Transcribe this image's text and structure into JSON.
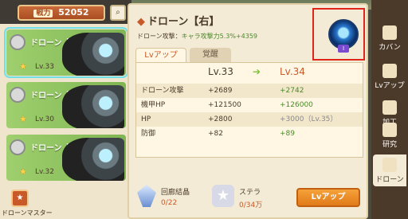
{
  "left": {
    "power_label": "戦力",
    "power_value": "52052",
    "cards": [
      {
        "name": "ドローン【右】",
        "level": "Lv.33"
      },
      {
        "name": "ドローン【左】",
        "level": "Lv.30"
      },
      {
        "name": "ドローン【頭】",
        "level": "Lv.32"
      }
    ],
    "master_label": "ドローンマスター"
  },
  "main": {
    "title": "ドローン【右】",
    "subtitle_prefix": "ドローン攻撃：",
    "subtitle_value": "キャラ攻撃力5.3%+4359",
    "tabs": [
      "Lvアップ",
      "覚醒"
    ],
    "level_current": "Lv.33",
    "level_next": "Lv.34",
    "stats": [
      {
        "label": "ドローン攻撃",
        "current": "+2689",
        "next": "+2742"
      },
      {
        "label": "機甲HP",
        "current": "+121500",
        "next": "+126000"
      },
      {
        "label": "HP",
        "current": "+2800",
        "next": "+3000（Lv.35）"
      },
      {
        "label": "防御",
        "current": "+82",
        "next": "+89"
      }
    ],
    "items": [
      {
        "name": "回廊結晶",
        "count": "0/22"
      },
      {
        "name": "ステラ",
        "count": "0/34万"
      }
    ],
    "lvup_button": "Lvアップ"
  },
  "right_menu": [
    "カバン",
    "Lvアップ",
    "加工",
    "研究",
    "ドローン"
  ]
}
